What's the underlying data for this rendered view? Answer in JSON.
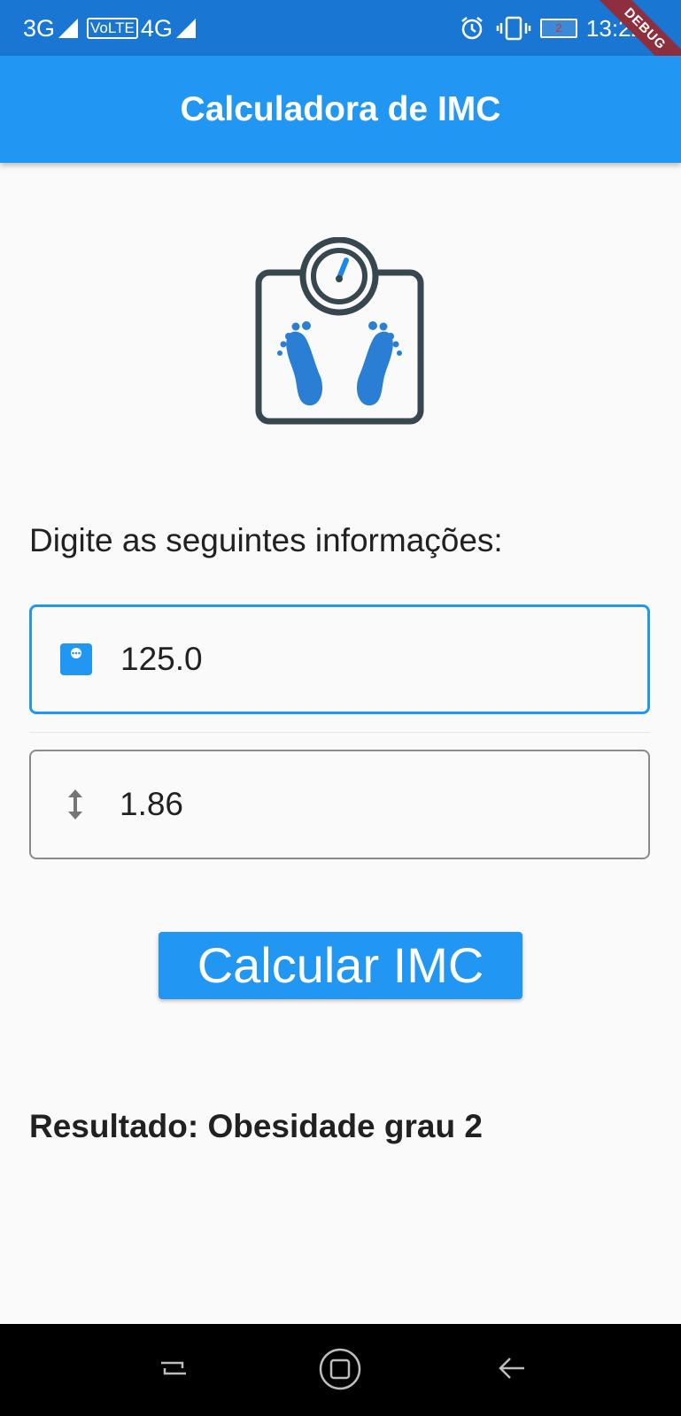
{
  "status_bar": {
    "network_1": "3G",
    "volte": "VoLTE",
    "network_2": "4G",
    "battery_level": "2",
    "time": "13:22"
  },
  "debug_banner": "DEBUG",
  "app_bar": {
    "title": "Calculadora de IMC"
  },
  "hero": {
    "icon": "bathroom-scale-icon"
  },
  "form": {
    "prompt": "Digite as seguintes informações:",
    "weight": {
      "value": "125.0",
      "icon": "scale-small-icon"
    },
    "height": {
      "value": "1.86",
      "icon": "vertical-arrows-icon"
    }
  },
  "calculate_button": {
    "label": "Calcular IMC"
  },
  "result": {
    "text": "Resultado: Obesidade grau 2"
  },
  "colors": {
    "primary": "#2196f3",
    "status_bar": "#1976d2",
    "icon_dark": "#37474f"
  }
}
